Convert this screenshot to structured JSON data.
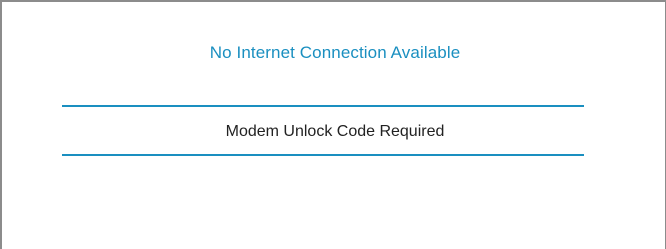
{
  "screen": {
    "title": "No Internet Connection Available",
    "message": "Modem Unlock Code Required"
  },
  "colors": {
    "accent": "#1a8fc0",
    "text": "#222222",
    "border": "#8c8c8c",
    "background": "#ffffff"
  }
}
